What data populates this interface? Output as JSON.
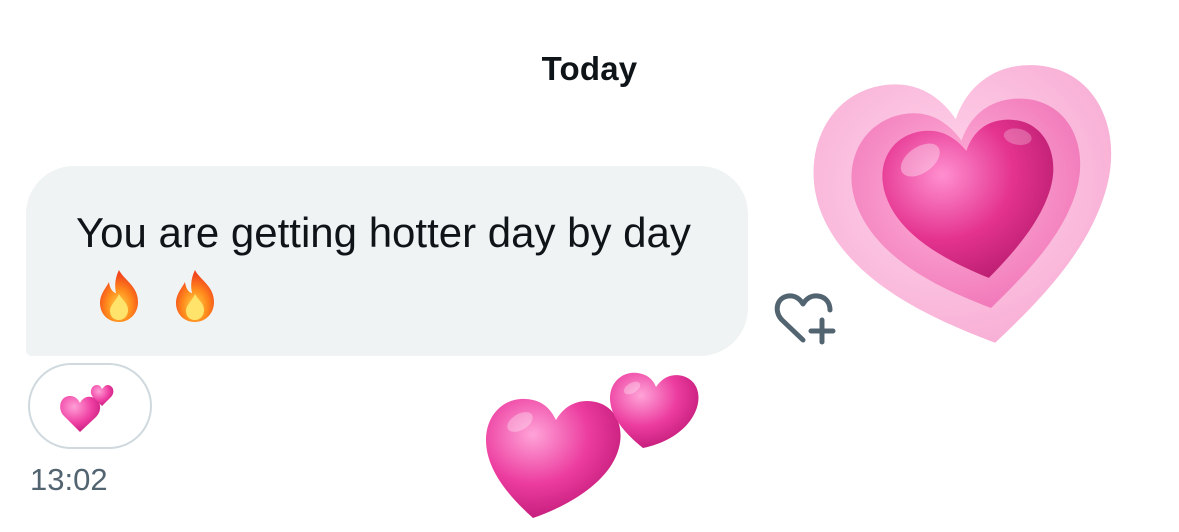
{
  "conversation": {
    "date_label": "Today",
    "message": {
      "text": "You are getting hotter day by day",
      "emoji": [
        "fire",
        "fire"
      ],
      "timestamp": "13:02"
    },
    "reactions": [
      {
        "emoji": "two-hearts"
      }
    ]
  },
  "effects": {
    "floating_emoji": [
      "growing-heart",
      "two-hearts"
    ]
  },
  "colors": {
    "bubble_bg": "#eff3f4",
    "text": "#0f1419",
    "secondary_text": "#536471",
    "pill_border": "#cfd9de",
    "heart_pink": "#ea3f9a"
  }
}
